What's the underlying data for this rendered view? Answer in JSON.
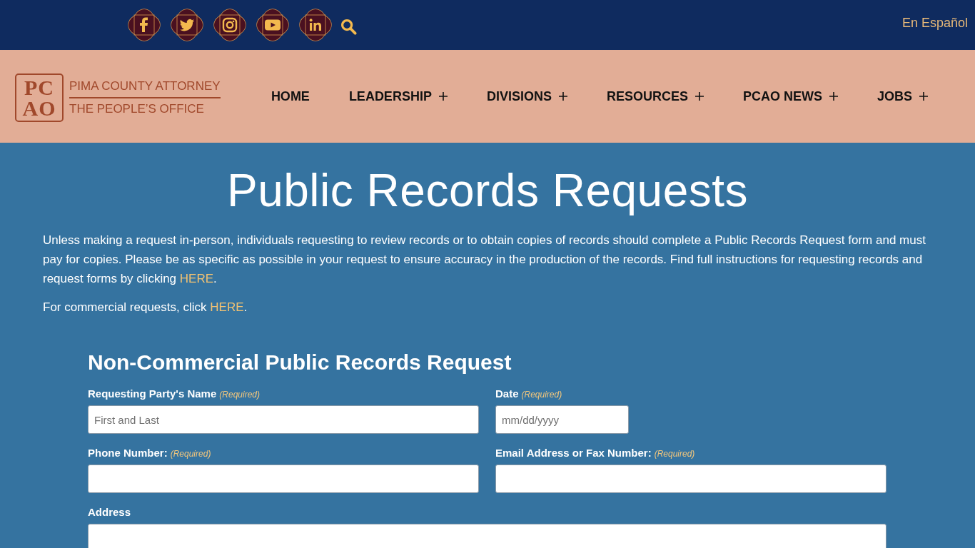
{
  "top_bar": {
    "language_link": "En Español"
  },
  "header": {
    "logo": {
      "initials": [
        "PC",
        "AO"
      ],
      "line_1": "PIMA COUNTY ATTORNEY",
      "line_2": "THE PEOPLE’S OFFICE"
    },
    "nav": [
      {
        "label": "HOME",
        "expandable": false
      },
      {
        "label": "LEADERSHIP",
        "expandable": true
      },
      {
        "label": "DIVISIONS",
        "expandable": true
      },
      {
        "label": "RESOURCES",
        "expandable": true
      },
      {
        "label": "PCAO NEWS",
        "expandable": true
      },
      {
        "label": "JOBS",
        "expandable": true
      }
    ]
  },
  "intro": {
    "title": "Public Records Requests",
    "paragraphs": [
      {
        "text": "Unless making a request in-person, individuals requesting to review records or to obtain copies of records should complete a Public Records Request form and must pay for copies. Please be as specific as possible in your request to ensure accuracy in the production of the records. Find full instructions for requesting records and request forms by clicking",
        "link": "HERE",
        "after": "."
      },
      {
        "text": "For commercial requests, click",
        "link": "HERE",
        "after": "."
      }
    ]
  },
  "form": {
    "title": "Non-Commercial Public Records Request",
    "rows": [
      {
        "fields": [
          {
            "kind": "text",
            "label": "Requesting Party's Name",
            "note": "(Required)",
            "placeholder": "First and Last"
          },
          {
            "kind": "date",
            "label": "Date",
            "note": "(Required)",
            "placeholder": "mm/dd/yyyy"
          }
        ]
      },
      {
        "fields": [
          {
            "kind": "text",
            "label": "Phone Number:",
            "note": "(Required)"
          },
          {
            "kind": "text",
            "label": "Email Address or Fax Number:",
            "note": "(Required)"
          }
        ]
      },
      {
        "fields": [
          {
            "kind": "text",
            "label": "Address"
          }
        ]
      }
    ]
  }
}
